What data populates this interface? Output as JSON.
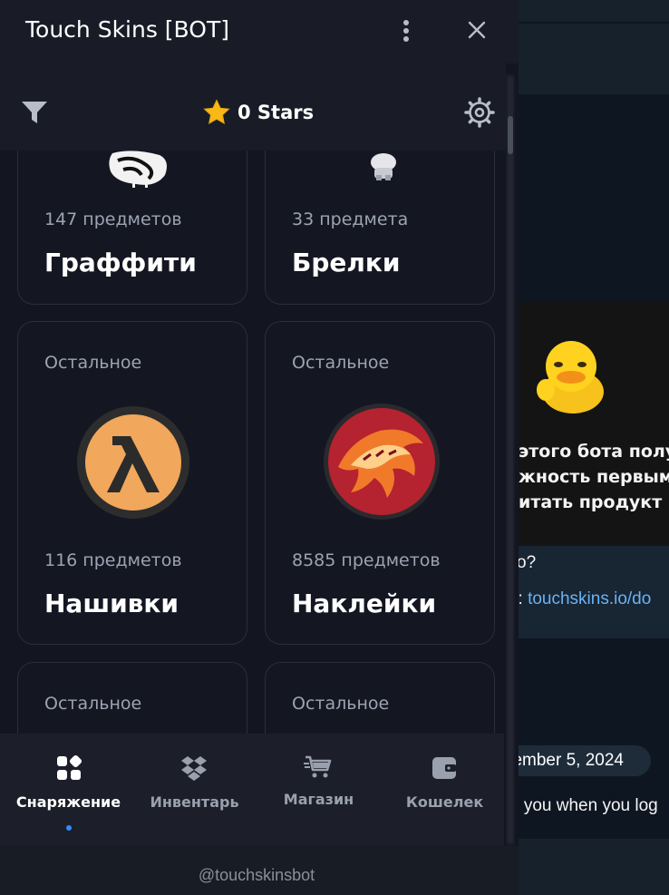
{
  "window": {
    "title": "Touch Skins [BOT]",
    "close_icon": "close-icon",
    "menu_icon": "more-vertical-icon"
  },
  "toolbar": {
    "filter_icon": "filter-icon",
    "stars_icon": "star-icon",
    "stars_label": "0 Stars",
    "settings_icon": "gear-icon"
  },
  "cards": [
    {
      "tag": "",
      "count": "147 предметов",
      "name": "Граффити",
      "icon": "graffiti-image"
    },
    {
      "tag": "",
      "count": "33 предмета",
      "name": "Брелки",
      "icon": "charm-image"
    },
    {
      "tag": "Остальное",
      "count": "116 предметов",
      "name": "Нашивки",
      "icon": "lambda-patch-image"
    },
    {
      "tag": "Остальное",
      "count": "8585 предметов",
      "name": "Наклейки",
      "icon": "dragon-sticker-image"
    },
    {
      "tag": "Остальное",
      "count": "",
      "name": "",
      "icon": ""
    },
    {
      "tag": "Остальное",
      "count": "",
      "name": "",
      "icon": ""
    }
  ],
  "nav": {
    "items": [
      {
        "label": "Снаряжение",
        "icon": "grid-shapes-icon",
        "active": true
      },
      {
        "label": "Инвентарь",
        "icon": "dropbox-icon",
        "active": false
      },
      {
        "label": "Магазин",
        "icon": "cart-icon",
        "active": false
      },
      {
        "label": "Кошелек",
        "icon": "wallet-icon",
        "active": false
      }
    ]
  },
  "footer": {
    "handle": "@touchskinsbot"
  },
  "chat": {
    "promo_lines": [
      " этого бота полу",
      "жность первыми",
      "итать продукт"
    ],
    "question": "о?",
    "link_prefix": "s: ",
    "link_text": "touchskins.io/do",
    "date": "ember 5, 2024",
    "last_message": "e you when you log"
  },
  "colors": {
    "accent": "#2f8cff",
    "panel_bg": "#131620",
    "card_border": "#2a2e3a",
    "link": "#6ab3f3"
  }
}
